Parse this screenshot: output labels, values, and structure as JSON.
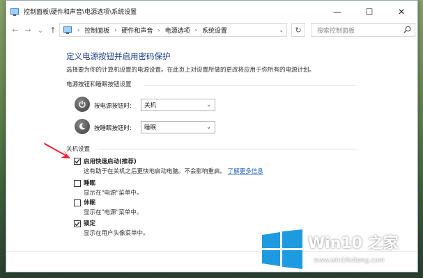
{
  "window": {
    "title": "控制面板\\硬件和声音\\电源选项\\系统设置",
    "minimize": "—",
    "maximize": "☐",
    "close": "✕"
  },
  "nav": {
    "back": "←",
    "forward": "→",
    "recent": "⌄",
    "up": "↑",
    "breadcrumbs": [
      "控制面板",
      "硬件和声音",
      "电源选项",
      "系统设置"
    ],
    "search_placeholder": "搜索控制面板"
  },
  "content": {
    "heading": "定义电源按钮并启用密码保护",
    "subtitle": "选择要为你的计算机设置的电源设置。在此页上对设置所做的更改将应用于你所有的电源计划。",
    "power_group_title": "电源按钮和睡眠按钮设置",
    "power_button_label": "按电源按钮时:",
    "power_button_value": "关机",
    "sleep_button_label": "按睡眠按钮时:",
    "sleep_button_value": "睡眠",
    "shutdown_group_title": "关机设置",
    "options": [
      {
        "label": "启用快速启动(推荐)",
        "desc": "这有助于在关机之后更快地启动电脑。不会影响重启。",
        "link": "了解更多信息",
        "checked": true
      },
      {
        "label": "睡眠",
        "desc": "显示在\"电源\"菜单中。",
        "checked": false
      },
      {
        "label": "休眠",
        "desc": "显示在\"电源\"菜单中。",
        "checked": false
      },
      {
        "label": "锁定",
        "desc": "显示在用户头像菜单中。",
        "checked": true
      }
    ]
  },
  "watermark": {
    "title": "Win10 之家",
    "url": "www.win10xitong.com"
  },
  "colors": {
    "heading": "#1a3a8a",
    "link": "#1a5fb4",
    "annotation_arrow": "#e8232a",
    "logo_blue": "#1e9be0"
  }
}
